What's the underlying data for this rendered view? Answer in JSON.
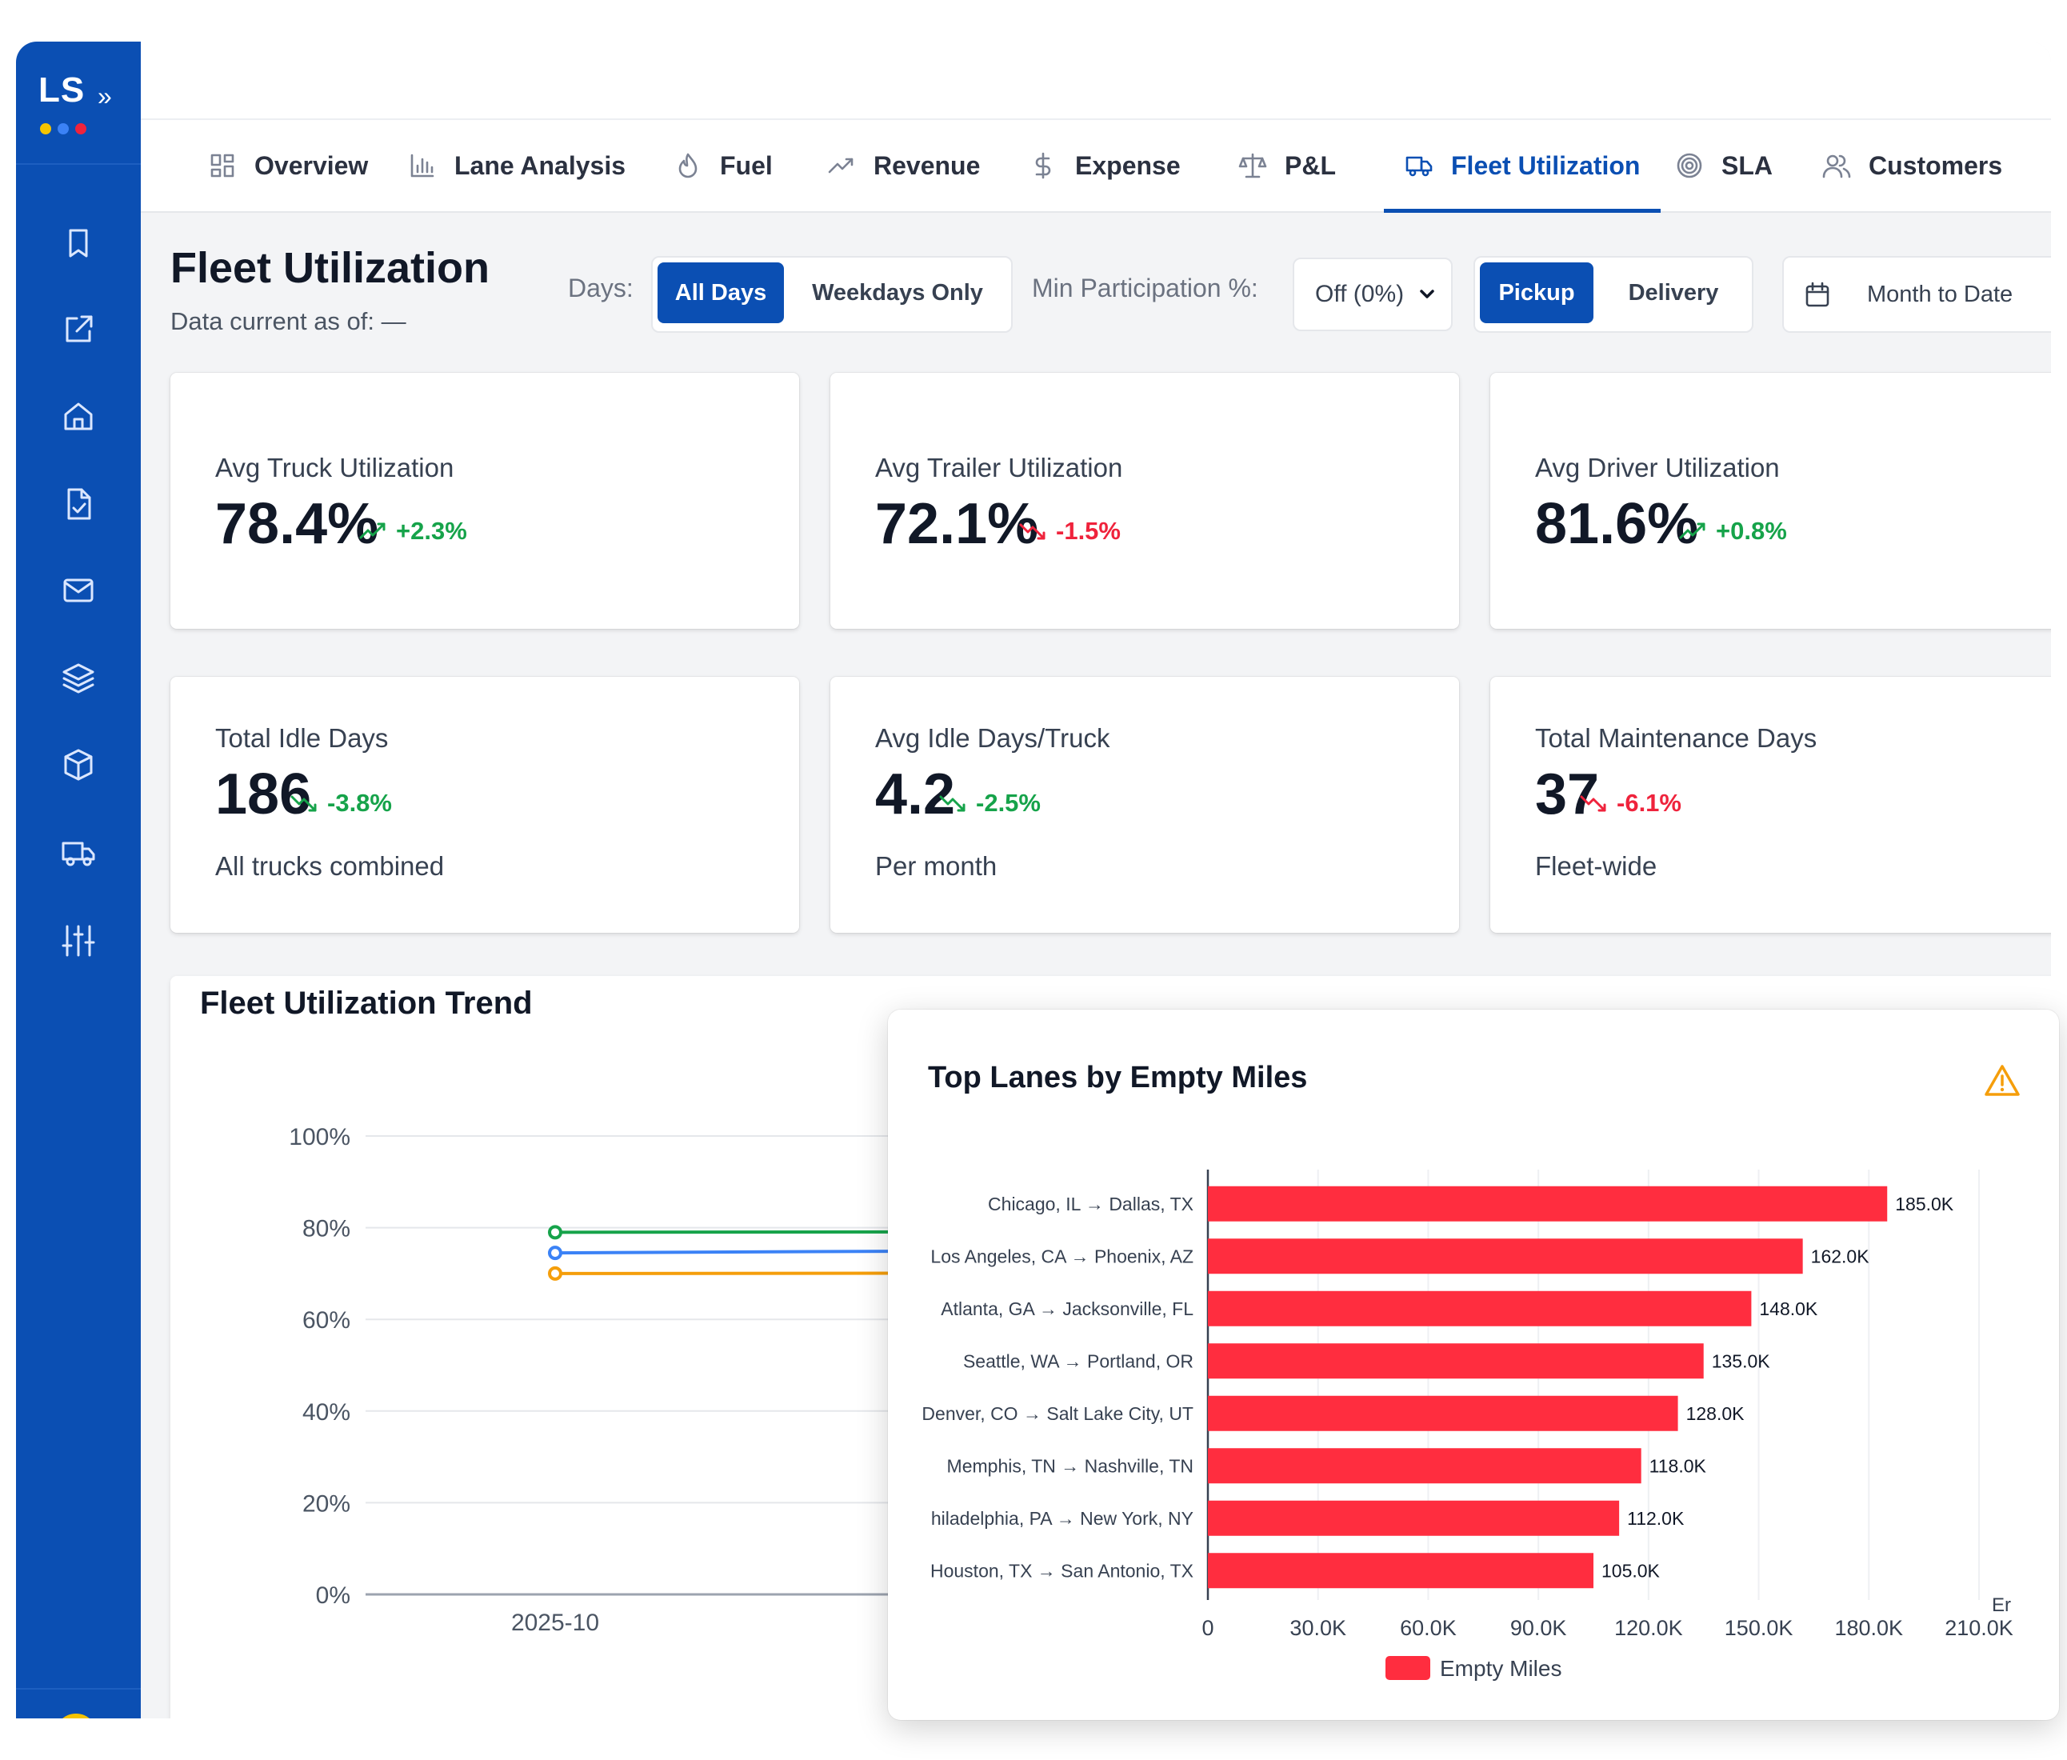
{
  "app": {
    "logo_text": "LS",
    "logo_chevron": "»",
    "logo_dot_colors": [
      "#f5c400",
      "#3b82f6",
      "#ef233c"
    ]
  },
  "sidebar": {
    "icons": [
      "bookmark-icon",
      "external-link-icon",
      "home-icon",
      "file-check-icon",
      "mail-icon",
      "layers-icon",
      "package-icon",
      "truck-icon",
      "sliders-icon"
    ]
  },
  "tabs": [
    {
      "label": "Overview",
      "icon": "grid-icon"
    },
    {
      "label": "Lane Analysis",
      "icon": "bar-chart-icon"
    },
    {
      "label": "Fuel",
      "icon": "flame-icon"
    },
    {
      "label": "Revenue",
      "icon": "trending-up-icon"
    },
    {
      "label": "Expense",
      "icon": "dollar-icon"
    },
    {
      "label": "P&L",
      "icon": "scale-icon"
    },
    {
      "label": "Fleet Utilization",
      "icon": "truck-icon",
      "active": true
    },
    {
      "label": "SLA",
      "icon": "target-icon"
    },
    {
      "label": "Customers",
      "icon": "users-icon"
    }
  ],
  "header": {
    "title": "Fleet Utilization",
    "data_current": "Data current as of: —"
  },
  "filters": {
    "days_label": "Days:",
    "days_options": [
      "All Days",
      "Weekdays Only"
    ],
    "days_selected": "All Days",
    "min_participation_label": "Min Participation %:",
    "min_participation_value": "Off (0%)",
    "mode_options": [
      "Pickup",
      "Delivery"
    ],
    "mode_selected": "Pickup",
    "date_range": "Month to Date"
  },
  "kpis": [
    {
      "label": "Avg Truck Utilization",
      "value": "78.4%",
      "delta": "+2.3%",
      "trend": "up",
      "color": "#16a34a"
    },
    {
      "label": "Avg Trailer Utilization",
      "value": "72.1%",
      "delta": "-1.5%",
      "trend": "down",
      "color": "#ef233c"
    },
    {
      "label": "Avg Driver Utilization",
      "value": "81.6%",
      "delta": "+0.8%",
      "trend": "up",
      "color": "#16a34a"
    },
    {
      "label": "Total Idle Days",
      "value": "186",
      "delta": "-3.8%",
      "trend": "down",
      "color": "#16a34a",
      "sub": "All trucks combined"
    },
    {
      "label": "Avg Idle Days/Truck",
      "value": "4.2",
      "delta": "-2.5%",
      "trend": "down",
      "color": "#16a34a",
      "sub": "Per month"
    },
    {
      "label": "Total Maintenance Days",
      "value": "37",
      "delta": "-6.1%",
      "trend": "down",
      "color": "#ef233c",
      "sub": "Fleet-wide"
    }
  ],
  "chart_data": [
    {
      "type": "line",
      "title": "Fleet Utilization Trend",
      "x": [
        "2025-10"
      ],
      "y_ticks": [
        "0%",
        "20%",
        "40%",
        "60%",
        "80%",
        "100%"
      ],
      "ylim": [
        0,
        100
      ],
      "grid": true,
      "series": [
        {
          "color": "#16a34a",
          "values": [
            79
          ]
        },
        {
          "color": "#3b82f6",
          "values": [
            74.5
          ]
        },
        {
          "color": "#f59e0b",
          "values": [
            70
          ]
        }
      ]
    },
    {
      "type": "bar",
      "orientation": "horizontal",
      "title": "Top Lanes by Empty Miles",
      "categories": [
        "Chicago, IL → Dallas, TX",
        "Los Angeles, CA → Phoenix, AZ",
        "Atlanta, GA → Jacksonville, FL",
        "Seattle, WA → Portland, OR",
        "Denver, CO → Salt Lake City, UT",
        "Memphis, TN → Nashville, TN",
        "hiladelphia, PA → New York, NY",
        "Houston, TX → San Antonio, TX"
      ],
      "series": [
        {
          "name": "Empty Miles",
          "color": "#ff2d3f",
          "values": [
            185000,
            162000,
            148000,
            135000,
            128000,
            118000,
            112000,
            105000
          ]
        }
      ],
      "data_labels": [
        "185.0K",
        "162.0K",
        "148.0K",
        "135.0K",
        "128.0K",
        "118.0K",
        "112.0K",
        "105.0K"
      ],
      "x_ticks": [
        "0",
        "30.0K",
        "60.0K",
        "90.0K",
        "120.0K",
        "150.0K",
        "180.0K",
        "210.0K"
      ],
      "xlim": [
        0,
        210000
      ],
      "axis_label_partial": "Er",
      "legend_position": "bottom"
    }
  ]
}
